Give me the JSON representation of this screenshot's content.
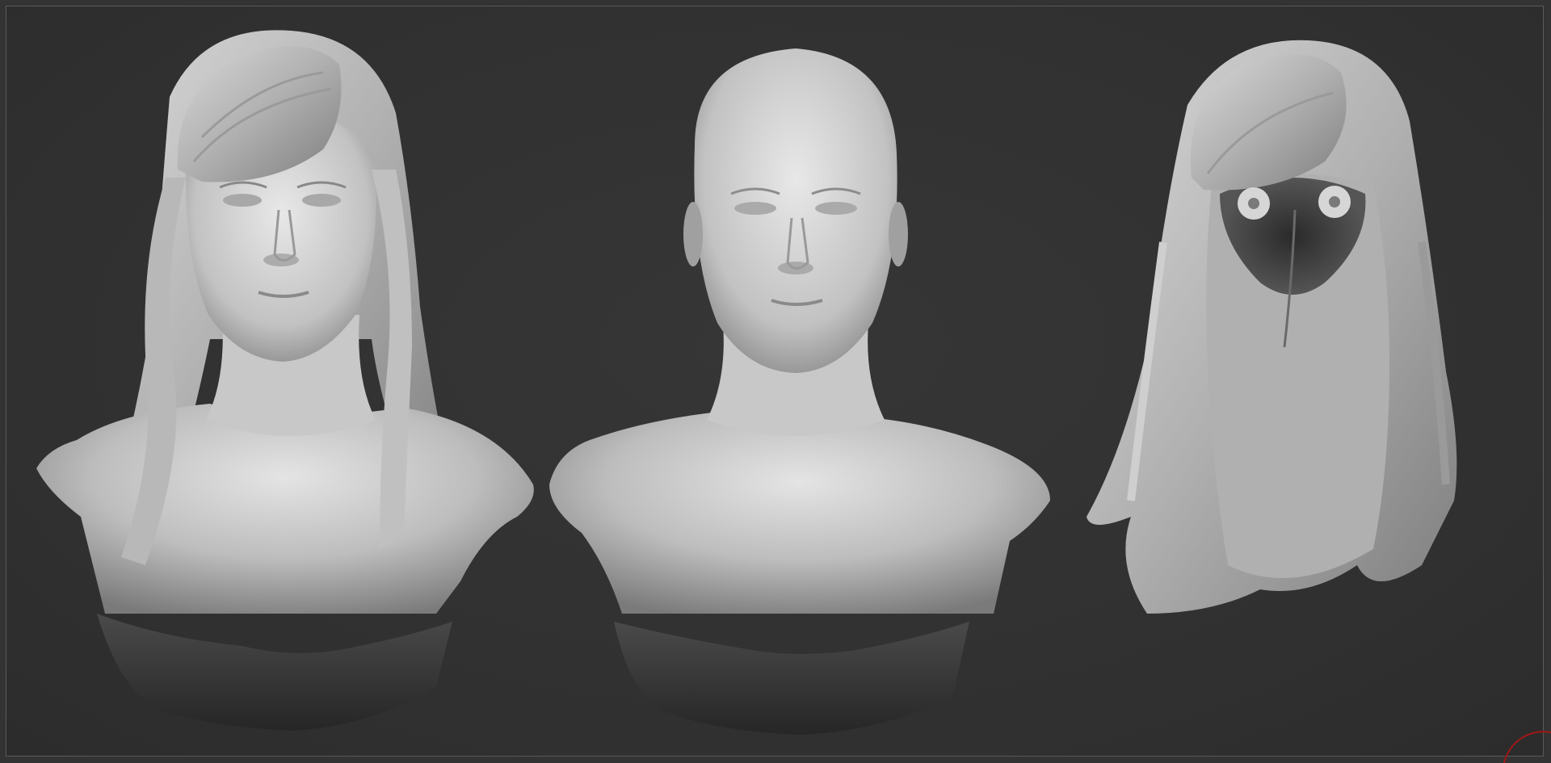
{
  "viewport": {
    "background": "#333333",
    "frame_border": "#5a5a5a",
    "clay_color": "#bdbdbd"
  },
  "models": [
    {
      "name": "bust-with-hair",
      "icon": "sculpt-bust-hair"
    },
    {
      "name": "bald-bust",
      "icon": "sculpt-bust-bald"
    },
    {
      "name": "hair-mesh-with-eyes",
      "icon": "sculpt-hair-eyes"
    }
  ],
  "gizmo": {
    "icon": "rotation-arc-icon",
    "color": "#a01818"
  }
}
